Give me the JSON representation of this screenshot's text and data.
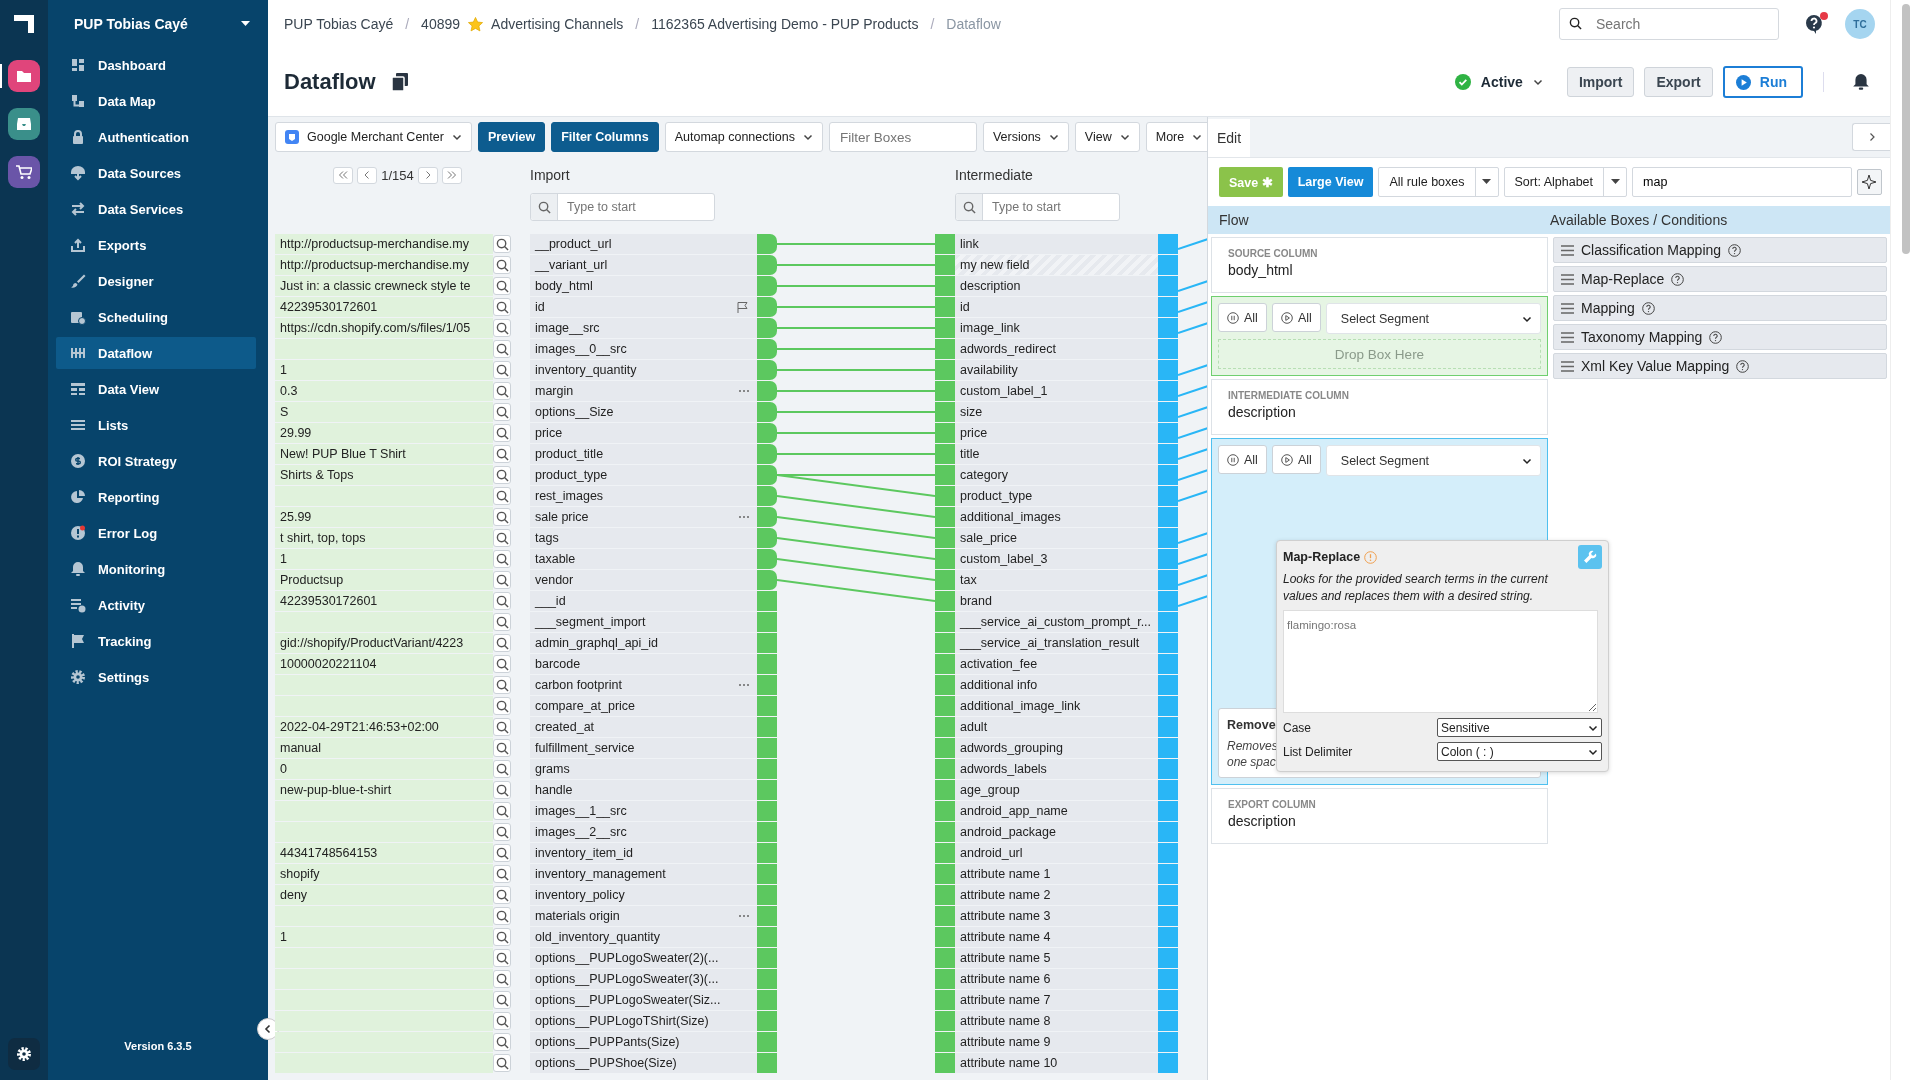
{
  "rail_apps": [
    {
      "selected": true,
      "color": "#e0457b"
    },
    {
      "selected": false,
      "color": "#3a8f8a"
    },
    {
      "selected": false,
      "color": "#6a55a8"
    }
  ],
  "sidebar": {
    "org": "PUP Tobias Cayé",
    "version": "Version 6.3.5",
    "items": [
      {
        "label": "Dashboard",
        "selected": false
      },
      {
        "label": "Data Map",
        "selected": false
      },
      {
        "label": "Authentication",
        "selected": false
      },
      {
        "label": "Data Sources",
        "selected": false
      },
      {
        "label": "Data Services",
        "selected": false
      },
      {
        "label": "Exports",
        "selected": false
      },
      {
        "label": "Designer",
        "selected": false
      },
      {
        "label": "Scheduling",
        "selected": false
      },
      {
        "label": "Dataflow",
        "selected": true
      },
      {
        "label": "Data View",
        "selected": false
      },
      {
        "label": "Lists",
        "selected": false
      },
      {
        "label": "ROI Strategy",
        "selected": false
      },
      {
        "label": "Reporting",
        "selected": false
      },
      {
        "label": "Error Log",
        "selected": false
      },
      {
        "label": "Monitoring",
        "selected": false
      },
      {
        "label": "Activity",
        "selected": false
      },
      {
        "label": "Tracking",
        "selected": false
      },
      {
        "label": "Settings",
        "selected": false
      }
    ]
  },
  "breadcrumbs": [
    {
      "text": "PUP Tobias Cayé",
      "current": false
    },
    {
      "separator": "/",
      "number": "40899",
      "text": "Advertising Channels",
      "current": false
    },
    {
      "separator": "/",
      "text": "1162365 Advertising Demo - PUP Products",
      "current": false
    },
    {
      "separator": "/",
      "text": "Dataflow",
      "current": true
    }
  ],
  "search": {
    "placeholder": "Search"
  },
  "help_badge": true,
  "avatar": "TC",
  "title": "Dataflow",
  "status": {
    "label": "Active",
    "active": true
  },
  "actions": [
    "Import",
    "Export"
  ],
  "run": "Run",
  "toolbar": {
    "channel": "Google Merchant Center",
    "buttons": [
      "Preview",
      "Filter Columns"
    ],
    "automap": "Automap connections",
    "filter_placeholder": "Filter Boxes",
    "menus": [
      "Versions",
      "View",
      "More"
    ]
  },
  "pager": "1/154",
  "import_header": "Import",
  "intermediate_header": "Intermediate",
  "column_search_placeholders": [
    "Type to start",
    "Type to start"
  ],
  "rows": [
    {
      "sample": "http://productsup-merchandise.my",
      "import": "__product_url",
      "flagged": false,
      "menu": false,
      "intermediate": "link",
      "kind": "field",
      "linked": true,
      "linked_next": false,
      "exported": true
    },
    {
      "sample": "http://productsup-merchandise.my",
      "import": "__variant_url",
      "flagged": false,
      "menu": false,
      "intermediate": "my new field",
      "kind": "new",
      "linked": true,
      "linked_next": false,
      "exported": false
    },
    {
      "sample": "Just in: a classic crewneck style te",
      "import": "body_html",
      "flagged": false,
      "menu": false,
      "intermediate": "description",
      "kind": "field",
      "linked": true,
      "linked_next": false,
      "exported": true
    },
    {
      "sample": "42239530172601",
      "import": "id",
      "flagged": true,
      "menu": false,
      "intermediate": "id",
      "kind": "field",
      "linked": true,
      "linked_next": false,
      "exported": true
    },
    {
      "sample": "https://cdn.shopify.com/s/files/1/05",
      "import": "image__src",
      "flagged": false,
      "menu": false,
      "intermediate": "image_link",
      "kind": "field",
      "linked": true,
      "linked_next": false,
      "exported": true
    },
    {
      "import": "images__0__src",
      "flagged": false,
      "menu": false,
      "intermediate": "adwords_redirect",
      "kind": "field",
      "linked": true,
      "linked_next": false,
      "exported": false
    },
    {
      "sample": "1",
      "import": "inventory_quantity",
      "flagged": false,
      "menu": false,
      "intermediate": "availability",
      "kind": "field",
      "linked": true,
      "linked_next": false,
      "exported": true
    },
    {
      "sample": "0.3",
      "import": "margin",
      "flagged": false,
      "menu": true,
      "intermediate": "custom_label_1",
      "kind": "field",
      "linked": true,
      "linked_next": false,
      "exported": true
    },
    {
      "sample": "S",
      "import": "options__Size",
      "flagged": false,
      "menu": false,
      "intermediate": "size",
      "kind": "field",
      "linked": true,
      "linked_next": false,
      "exported": true
    },
    {
      "sample": "29.99",
      "import": "price",
      "flagged": false,
      "menu": false,
      "intermediate": "price",
      "kind": "field",
      "linked": true,
      "linked_next": false,
      "exported": true
    },
    {
      "sample": "New! PUP Blue T Shirt",
      "import": "product_title",
      "flagged": false,
      "menu": false,
      "intermediate": "title",
      "kind": "field",
      "linked": true,
      "linked_next": false,
      "exported": true
    },
    {
      "sample": "Shirts & Tops",
      "import": "product_type",
      "flagged": false,
      "menu": false,
      "intermediate": "category",
      "kind": "field",
      "linked": true,
      "linked_next": true,
      "exported": true
    },
    {
      "import": "rest_images",
      "flagged": false,
      "menu": false,
      "intermediate": "product_type",
      "kind": "field",
      "linked": false,
      "linked_next": true,
      "exported": true
    },
    {
      "sample": "25.99",
      "import": "sale price",
      "flagged": false,
      "menu": true,
      "intermediate": "additional_images",
      "kind": "field",
      "linked": false,
      "linked_next": true,
      "exported": false
    },
    {
      "sample": "t shirt, top, tops",
      "import": "tags",
      "flagged": false,
      "menu": false,
      "intermediate": "sale_price",
      "kind": "field",
      "linked": false,
      "linked_next": true,
      "exported": true
    },
    {
      "sample": "1",
      "import": "taxable",
      "flagged": false,
      "menu": false,
      "intermediate": "custom_label_3",
      "kind": "field",
      "linked": false,
      "linked_next": true,
      "exported": true
    },
    {
      "sample": "Productsup",
      "import": "vendor",
      "flagged": false,
      "menu": false,
      "intermediate": "tax",
      "kind": "field",
      "linked": false,
      "linked_next": true,
      "exported": true
    },
    {
      "sample": "42239530172601",
      "import": "___id",
      "flagged": false,
      "menu": false,
      "intermediate": "brand",
      "kind": "field",
      "linked": false,
      "linked_next": false,
      "exported": true
    },
    {
      "import": "___segment_import",
      "flagged": false,
      "menu": false,
      "intermediate": "___service_ai_custom_prompt_r...",
      "kind": "field",
      "linked": false,
      "linked_next": false,
      "exported": false
    },
    {
      "sample": "gid://shopify/ProductVariant/4223",
      "import": "admin_graphql_api_id",
      "flagged": false,
      "menu": false,
      "intermediate": "___service_ai_translation_result",
      "kind": "field",
      "linked": false,
      "linked_next": false,
      "exported": false
    },
    {
      "sample": "10000020221104",
      "import": "barcode",
      "flagged": false,
      "menu": false,
      "intermediate": "activation_fee",
      "kind": "field",
      "linked": false,
      "linked_next": false,
      "exported": false
    },
    {
      "import": "carbon footprint",
      "flagged": false,
      "menu": true,
      "intermediate": "additional info",
      "kind": "field",
      "linked": false,
      "linked_next": false,
      "exported": false
    },
    {
      "import": "compare_at_price",
      "flagged": false,
      "menu": false,
      "intermediate": "additional_image_link",
      "kind": "field",
      "linked": false,
      "linked_next": false,
      "exported": false
    },
    {
      "sample": "2022-04-29T21:46:53+02:00",
      "import": "created_at",
      "flagged": false,
      "menu": false,
      "intermediate": "adult",
      "kind": "field",
      "linked": false,
      "linked_next": false,
      "exported": false
    },
    {
      "sample": "manual",
      "import": "fulfillment_service",
      "flagged": false,
      "menu": false,
      "intermediate": "adwords_grouping",
      "kind": "field",
      "linked": false,
      "linked_next": false,
      "exported": false
    },
    {
      "sample": "0",
      "import": "grams",
      "flagged": false,
      "menu": false,
      "intermediate": "adwords_labels",
      "kind": "field",
      "linked": false,
      "linked_next": false,
      "exported": false
    },
    {
      "sample": "new-pup-blue-t-shirt",
      "import": "handle",
      "flagged": false,
      "menu": false,
      "intermediate": "age_group",
      "kind": "field",
      "linked": false,
      "linked_next": false,
      "exported": false
    },
    {
      "import": "images__1__src",
      "flagged": false,
      "menu": false,
      "intermediate": "android_app_name",
      "kind": "field",
      "linked": false,
      "linked_next": false,
      "exported": false
    },
    {
      "import": "images__2__src",
      "flagged": false,
      "menu": false,
      "intermediate": "android_package",
      "kind": "field",
      "linked": false,
      "linked_next": false,
      "exported": false
    },
    {
      "sample": "44341748564153",
      "import": "inventory_item_id",
      "flagged": false,
      "menu": false,
      "intermediate": "android_url",
      "kind": "field",
      "linked": false,
      "linked_next": false,
      "exported": false
    },
    {
      "sample": "shopify",
      "import": "inventory_management",
      "flagged": false,
      "menu": false,
      "intermediate": "attribute name 1",
      "kind": "field",
      "linked": false,
      "linked_next": false,
      "exported": false
    },
    {
      "sample": "deny",
      "import": "inventory_policy",
      "flagged": false,
      "menu": false,
      "intermediate": "attribute name 2",
      "kind": "field",
      "linked": false,
      "linked_next": false,
      "exported": false
    },
    {
      "import": "materials origin",
      "flagged": false,
      "menu": true,
      "intermediate": "attribute name 3",
      "kind": "field",
      "linked": false,
      "linked_next": false,
      "exported": false
    },
    {
      "sample": "1",
      "import": "old_inventory_quantity",
      "flagged": false,
      "menu": false,
      "intermediate": "attribute name 4",
      "kind": "field",
      "linked": false,
      "linked_next": false,
      "exported": false
    },
    {
      "import": "options__PUPLogoSweater(2)(...",
      "flagged": false,
      "menu": false,
      "intermediate": "attribute name 5",
      "kind": "field",
      "linked": false,
      "linked_next": false,
      "exported": false
    },
    {
      "import": "options__PUPLogoSweater(3)(...",
      "flagged": false,
      "menu": false,
      "intermediate": "attribute name 6",
      "kind": "field",
      "linked": false,
      "linked_next": false,
      "exported": false
    },
    {
      "import": "options__PUPLogoSweater(Siz...",
      "flagged": false,
      "menu": false,
      "intermediate": "attribute name 7",
      "kind": "field",
      "linked": false,
      "linked_next": false,
      "exported": false
    },
    {
      "import": "options__PUPLogoTShirt(Size)",
      "flagged": false,
      "menu": false,
      "intermediate": "attribute name 8",
      "kind": "field",
      "linked": false,
      "linked_next": false,
      "exported": false
    },
    {
      "import": "options__PUPPants(Size)",
      "flagged": false,
      "menu": false,
      "intermediate": "attribute name 9",
      "kind": "field",
      "linked": false,
      "linked_next": false,
      "exported": false
    },
    {
      "import": "options__PUPShoe(Size)",
      "flagged": false,
      "menu": false,
      "intermediate": "attribute name 10",
      "kind": "field",
      "linked": false,
      "linked_next": false,
      "exported": false
    }
  ],
  "edit": {
    "tab": "Edit",
    "save": "Save ✱",
    "large_view": "Large View",
    "rule_filter": "All rule boxes",
    "sort": "Sort: Alphabet",
    "search_value": "map",
    "flow_header": "Flow",
    "available_header": "Available Boxes / Conditions",
    "source": {
      "caption": "SOURCE COLUMN",
      "value": "body_html"
    },
    "intermediate": {
      "caption": "INTERMEDIATE COLUMN",
      "value": "description"
    },
    "export": {
      "caption": "EXPORT COLUMN",
      "value": "description"
    },
    "segments": [
      {
        "pause": "All",
        "play": "All",
        "select": "Select Segment",
        "drop": "Drop Box Here"
      },
      {
        "pause": "All",
        "play": "All",
        "select": "Select Segment"
      }
    ],
    "rule_box": {
      "title": "Remove",
      "lines": [
        "Removes",
        "one spac"
      ]
    },
    "popup": {
      "title": "Map-Replace",
      "description": "Looks for the provided search terms in the current values and replaces them with a desired string.",
      "placeholder": "flamingo:rosa",
      "case_label": "Case",
      "case_value": "Sensitive",
      "delimiter_label": "List Delimiter",
      "delimiter_value": "Colon ( : )"
    },
    "available": [
      "Classification Mapping",
      "Map-Replace",
      "Mapping",
      "Taxonomy Mapping",
      "Xml Key Value Mapping"
    ]
  }
}
